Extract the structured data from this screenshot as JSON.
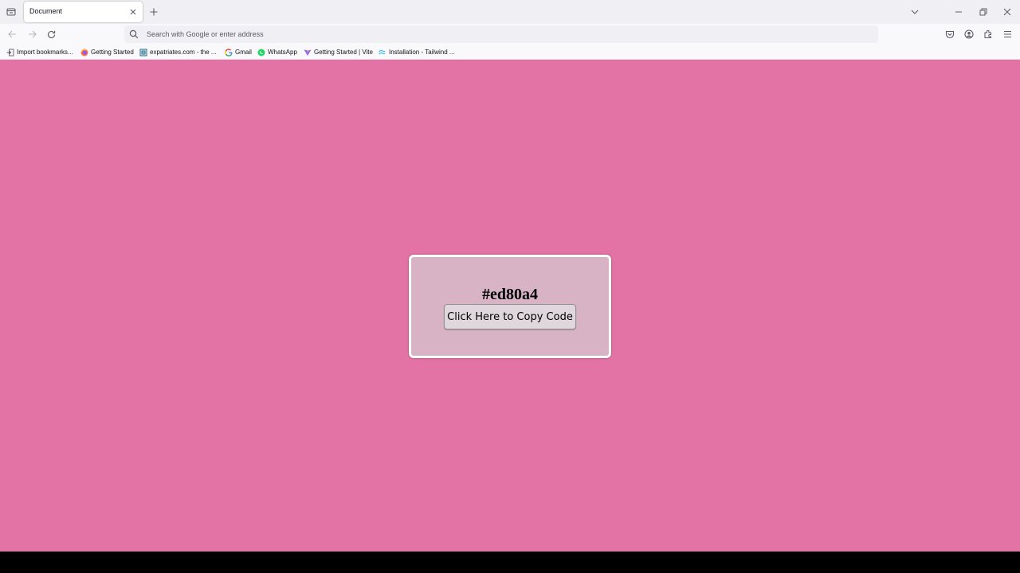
{
  "browser": {
    "tab": {
      "title": "Document"
    },
    "urlbar": {
      "placeholder": "Search with Google or enter address"
    },
    "bookmarks": [
      {
        "label": "Import bookmarks...",
        "icon": "import-icon"
      },
      {
        "label": "Getting Started",
        "icon": "firefox-icon"
      },
      {
        "label": "expatriates.com - the ...",
        "icon": "expatriates-icon"
      },
      {
        "label": "Gmail",
        "icon": "google-icon"
      },
      {
        "label": "WhatsApp",
        "icon": "whatsapp-icon"
      },
      {
        "label": "Getting Started | Vite",
        "icon": "vite-icon"
      },
      {
        "label": "Installation - Tailwind ...",
        "icon": "tailwind-icon"
      }
    ]
  },
  "page": {
    "background_color": "#e373a5",
    "hex_code": "#ed80a4",
    "copy_button_label": "Click Here to Copy Code"
  }
}
